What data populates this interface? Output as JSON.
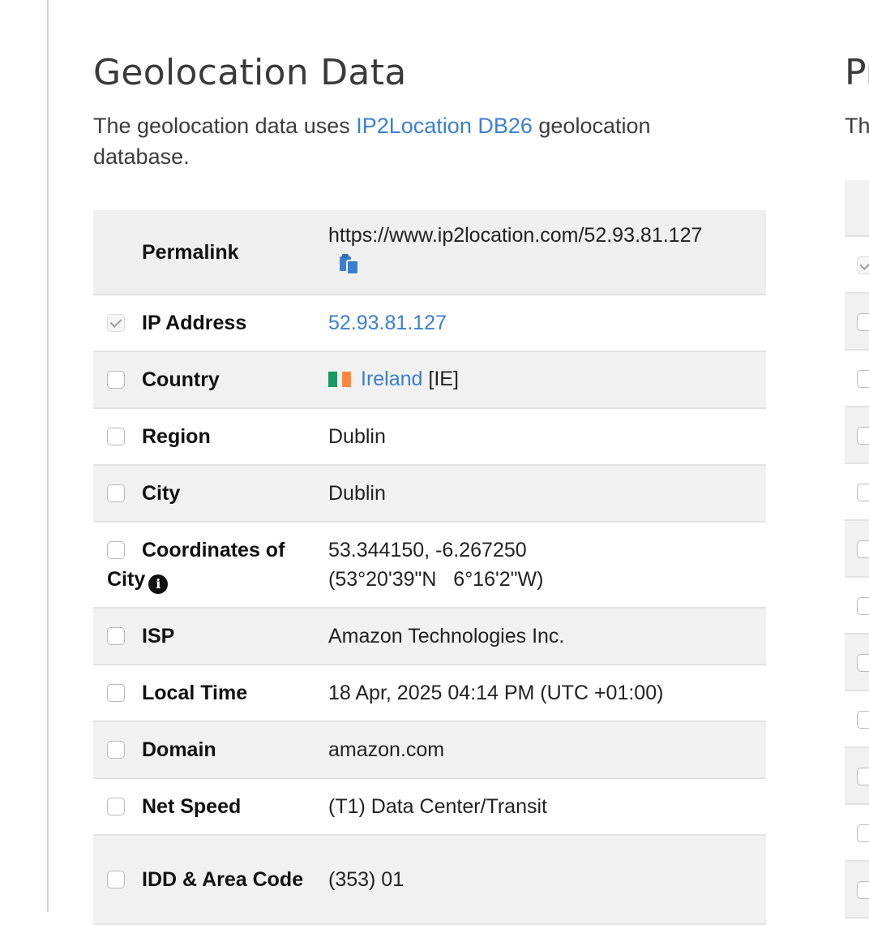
{
  "section": {
    "title": "Geolocation Data",
    "intro_before": "The geolocation data uses ",
    "intro_link": "IP2Location DB26",
    "intro_after": " geolocation database."
  },
  "rows": {
    "permalink": {
      "label": "Permalink",
      "value": "https://www.ip2location.com/52.93.81.127",
      "icon": "copy-icon"
    },
    "ip": {
      "label": "IP Address",
      "value": "52.93.81.127",
      "checked": true
    },
    "country": {
      "label": "Country",
      "value": "Ireland",
      "code": "[IE]",
      "flag_colors": [
        "#169b62",
        "#ff883e"
      ]
    },
    "region": {
      "label": "Region",
      "value": "Dublin"
    },
    "city": {
      "label": "City",
      "value": "Dublin"
    },
    "coords": {
      "label": "Coordinates of City",
      "value_line1": "53.344150, -6.267250",
      "value_line2": "(53°20'39\"N   6°16'2\"W)",
      "icon": "info-icon"
    },
    "isp": {
      "label": "ISP",
      "value": "Amazon Technologies Inc."
    },
    "local_time": {
      "label": "Local Time",
      "value": "18 Apr, 2025 04:14 PM (UTC +01:00)"
    },
    "domain": {
      "label": "Domain",
      "value": "amazon.com"
    },
    "net_speed": {
      "label": "Net Speed",
      "value": "(T1) Data Center/Transit"
    },
    "idd": {
      "label": "IDD & Area Code",
      "value": "(353) 01"
    }
  },
  "side": {
    "title": "Pr",
    "intro": "Th"
  },
  "colors": {
    "link": "#3a7fcf",
    "row_alt": "#f1f1f1",
    "copy_icon": "#3a7fcf"
  }
}
